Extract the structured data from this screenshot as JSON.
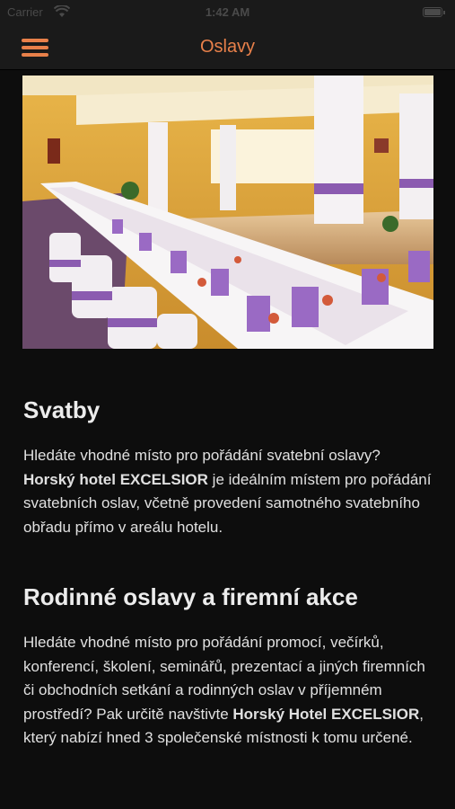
{
  "status_bar": {
    "carrier": "Carrier",
    "time": "1:42 AM"
  },
  "nav": {
    "title": "Oslavy"
  },
  "hero_image": {
    "alt": "wedding-hall-photo"
  },
  "sections": [
    {
      "heading": "Svatby",
      "text_before": "Hledáte vhodné místo pro pořádání svatební oslavy? ",
      "text_bold": "Horský hotel EXCELSIOR",
      "text_after": " je ideálním místem pro pořádání svatebních oslav, včetně provedení samotného svatebního obřadu přímo v areálu hotelu."
    },
    {
      "heading": "Rodinné oslavy a firemní akce",
      "text_before": "Hledáte vhodné místo pro pořádání promocí, večírků, konferencí, školení, seminářů, prezentací a jiných  firemních či obchodních setkání a rodinných oslav v příjemném prostředí? Pak určitě navštivte ",
      "text_bold": "Horský Hotel EXCELSIOR",
      "text_after": ", který nabízí hned 3 společenské místnosti k tomu určené."
    }
  ]
}
